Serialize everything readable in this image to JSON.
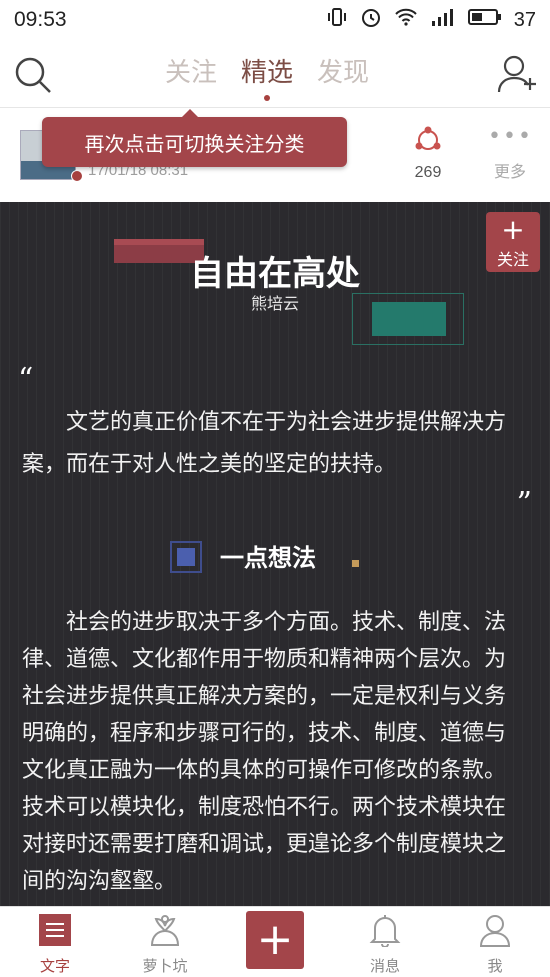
{
  "status_bar": {
    "time": "09:53",
    "battery": "37"
  },
  "nav": {
    "tabs": [
      {
        "label": "关注",
        "active": false
      },
      {
        "label": "精选",
        "active": true
      },
      {
        "label": "发现",
        "active": false
      }
    ]
  },
  "card": {
    "date": "17/01/18 08:31",
    "tooltip": "再次点击可切换关注分类",
    "share_count": "269",
    "more_label": "更多"
  },
  "article": {
    "follow_plus": "+",
    "follow_label": "关注",
    "title": "自由在高处",
    "author": "熊培云",
    "quote_open": "“",
    "quote_close": "”",
    "quote": "文艺的真正价值不在于为社会进步提供解决方案，而在于对人性之美的坚定的扶持。",
    "section_title": "一点想法",
    "body": "社会的进步取决于多个方面。技术、制度、法律、道德、文化都作用于物质和精神两个层次。为社会进步提供真正解决方案的，一定是权利与义务明确的，程序和步骤可行的，技术、制度、道德与文化真正融为一体的具体的可操作可修改的条款。技术可以模块化，制度恐怕不行。两个技术模块在对接时还需要打磨和调试，更遑论多个制度模块之间的沟沟壑壑。"
  },
  "bottom_nav": {
    "items": [
      {
        "label": "文字",
        "icon": "document-icon",
        "active": true
      },
      {
        "label": "萝卜坑",
        "icon": "radish-icon",
        "active": false
      },
      {
        "label": "+",
        "icon": "plus-icon",
        "active": false
      },
      {
        "label": "消息",
        "icon": "bell-icon",
        "active": false
      },
      {
        "label": "我",
        "icon": "person-icon",
        "active": false
      }
    ]
  },
  "colors": {
    "accent": "#a3454a",
    "article_bg": "#2b2a2e",
    "active_tab": "#7c4d45",
    "inactive_tab": "#c9c0bc",
    "teal": "#247a6c",
    "section_blue": "#4b5fae"
  }
}
